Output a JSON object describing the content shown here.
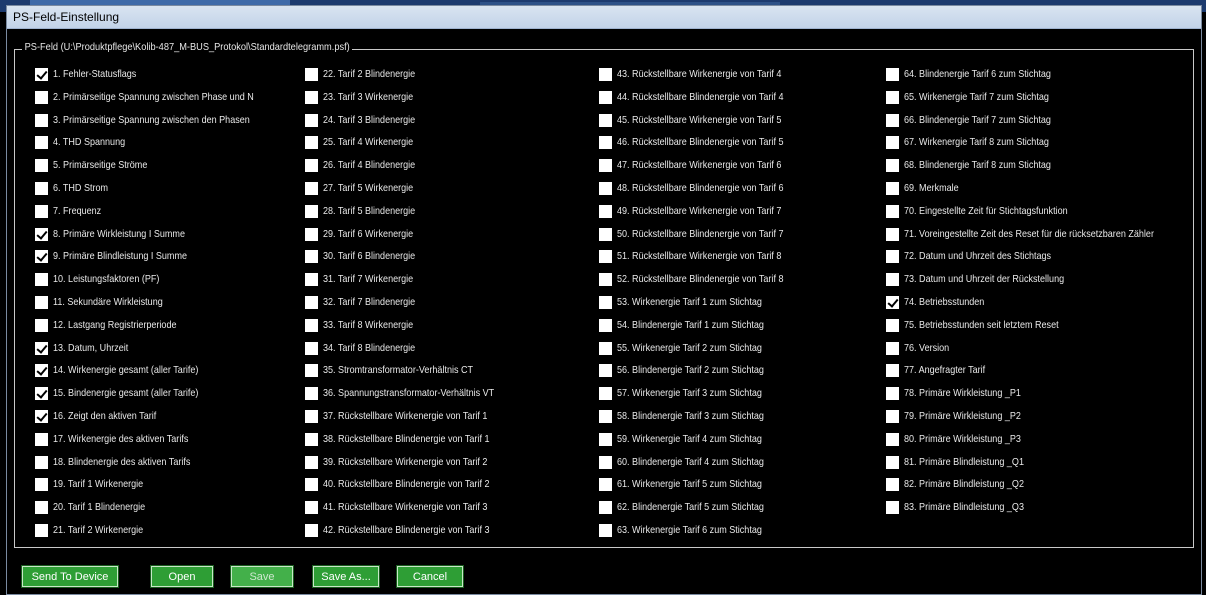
{
  "window": {
    "title": "PS-Feld-Einstellung"
  },
  "group": {
    "legend": "PS-Feld (U:\\Produktpflege\\Kolib-487_M-BUS_Protokol\\Standardtelegramm.psf)"
  },
  "fields": [
    {
      "label": "1. Fehler-Statusflags",
      "checked": true
    },
    {
      "label": "2. Primärseitige Spannung zwischen Phase und N",
      "checked": false
    },
    {
      "label": "3. Primärseitige Spannung zwischen den Phasen",
      "checked": false
    },
    {
      "label": "4. THD Spannung",
      "checked": false
    },
    {
      "label": "5. Primärseitige Ströme",
      "checked": false
    },
    {
      "label": "6. THD Strom",
      "checked": false
    },
    {
      "label": "7. Frequenz",
      "checked": false
    },
    {
      "label": "8. Primäre Wirkleistung I Summe",
      "checked": true
    },
    {
      "label": "9. Primäre Blindleistung I Summe",
      "checked": true
    },
    {
      "label": "10. Leistungsfaktoren (PF)",
      "checked": false
    },
    {
      "label": "11. Sekundäre Wirkleistung",
      "checked": false
    },
    {
      "label": "12. Lastgang Registrierperiode",
      "checked": false
    },
    {
      "label": "13. Datum, Uhrzeit",
      "checked": true
    },
    {
      "label": "14. Wirkenergie gesamt (aller Tarife)",
      "checked": true
    },
    {
      "label": "15. Bindenergie gesamt (aller Tarife)",
      "checked": true
    },
    {
      "label": "16. Zeigt den aktiven Tarif",
      "checked": true
    },
    {
      "label": "17. Wirkenergie des aktiven Tarifs",
      "checked": false
    },
    {
      "label": "18. Blindenergie des aktiven Tarifs",
      "checked": false
    },
    {
      "label": "19. Tarif 1 Wirkenergie",
      "checked": false
    },
    {
      "label": "20. Tarif 1 Blindenergie",
      "checked": false
    },
    {
      "label": "21. Tarif 2 Wirkenergie",
      "checked": false
    },
    {
      "label": "22. Tarif 2 Blindenergie",
      "checked": false
    },
    {
      "label": "23. Tarif 3 Wirkenergie",
      "checked": false
    },
    {
      "label": "24. Tarif 3 Blindenergie",
      "checked": false
    },
    {
      "label": "25. Tarif 4 Wirkenergie",
      "checked": false
    },
    {
      "label": "26. Tarif 4 Blindenergie",
      "checked": false
    },
    {
      "label": "27. Tarif 5 Wirkenergie",
      "checked": false
    },
    {
      "label": "28. Tarif 5 Blindenergie",
      "checked": false
    },
    {
      "label": "29. Tarif 6 Wirkenergie",
      "checked": false
    },
    {
      "label": "30. Tarif 6 Blindenergie",
      "checked": false
    },
    {
      "label": "31. Tarif 7 Wirkenergie",
      "checked": false
    },
    {
      "label": "32. Tarif 7 Blindenergie",
      "checked": false
    },
    {
      "label": "33. Tarif 8 Wirkenergie",
      "checked": false
    },
    {
      "label": "34. Tarif 8 Blindenergie",
      "checked": false
    },
    {
      "label": "35. Stromtransformator-Verhältnis CT",
      "checked": false
    },
    {
      "label": "36. Spannungstransformator-Verhältnis VT",
      "checked": false
    },
    {
      "label": "37. Rückstellbare Wirkenergie von Tarif 1",
      "checked": false
    },
    {
      "label": "38. Rückstellbare Blindenergie von Tarif 1",
      "checked": false
    },
    {
      "label": "39. Rückstellbare Wirkenergie von Tarif 2",
      "checked": false
    },
    {
      "label": "40. Rückstellbare Blindenergie von Tarif 2",
      "checked": false
    },
    {
      "label": "41. Rückstellbare Wirkenergie von Tarif 3",
      "checked": false
    },
    {
      "label": "42. Rückstellbare Blindenergie von Tarif 3",
      "checked": false
    },
    {
      "label": "43. Rückstellbare Wirkenergie von Tarif 4",
      "checked": false
    },
    {
      "label": "44. Rückstellbare Blindenergie von Tarif 4",
      "checked": false
    },
    {
      "label": "45. Rückstellbare Wirkenergie von Tarif 5",
      "checked": false
    },
    {
      "label": "46. Rückstellbare Blindenergie von Tarif 5",
      "checked": false
    },
    {
      "label": "47. Rückstellbare Wirkenergie von Tarif 6",
      "checked": false
    },
    {
      "label": "48. Rückstellbare Blindenergie von Tarif 6",
      "checked": false
    },
    {
      "label": "49. Rückstellbare Wirkenergie von Tarif 7",
      "checked": false
    },
    {
      "label": "50. Rückstellbare Blindenergie von Tarif 7",
      "checked": false
    },
    {
      "label": "51. Rückstellbare Wirkenergie von Tarif 8",
      "checked": false
    },
    {
      "label": "52. Rückstellbare Blindenergie von Tarif 8",
      "checked": false
    },
    {
      "label": "53. Wirkenergie Tarif 1 zum Stichtag",
      "checked": false
    },
    {
      "label": "54. Blindenergie Tarif 1 zum Stichtag",
      "checked": false
    },
    {
      "label": "55. Wirkenergie Tarif 2 zum Stichtag",
      "checked": false
    },
    {
      "label": "56. Blindenergie Tarif 2 zum Stichtag",
      "checked": false
    },
    {
      "label": "57. Wirkenergie Tarif 3 zum Stichtag",
      "checked": false
    },
    {
      "label": "58. Blindenergie Tarif 3 zum Stichtag",
      "checked": false
    },
    {
      "label": "59. Wirkenergie Tarif 4 zum Stichtag",
      "checked": false
    },
    {
      "label": "60. Blindenergie Tarif 4 zum Stichtag",
      "checked": false
    },
    {
      "label": "61. Wirkenergie Tarif 5 zum Stichtag",
      "checked": false
    },
    {
      "label": "62. Blindenergie Tarif 5 zum Stichtag",
      "checked": false
    },
    {
      "label": "63. Wirkenergie Tarif 6 zum Stichtag",
      "checked": false
    },
    {
      "label": "64. Blindenergie Tarif 6 zum Stichtag",
      "checked": false
    },
    {
      "label": "65. Wirkenergie Tarif 7 zum Stichtag",
      "checked": false
    },
    {
      "label": "66. Blindenergie Tarif 7 zum Stichtag",
      "checked": false
    },
    {
      "label": "67. Wirkenergie Tarif 8 zum Stichtag",
      "checked": false
    },
    {
      "label": "68. Blindenergie Tarif 8 zum Stichtag",
      "checked": false
    },
    {
      "label": "69. Merkmale",
      "checked": false
    },
    {
      "label": "70. Eingestellte Zeit für Stichtagsfunktion",
      "checked": false
    },
    {
      "label": "71. Voreingestellte Zeit des Reset für die rücksetzbaren Zähler",
      "checked": false
    },
    {
      "label": "72. Datum und Uhrzeit des Stichtags",
      "checked": false
    },
    {
      "label": "73. Datum und Uhrzeit der Rückstellung",
      "checked": false
    },
    {
      "label": "74. Betriebsstunden",
      "checked": true
    },
    {
      "label": "75. Betriebsstunden seit letztem Reset",
      "checked": false
    },
    {
      "label": "76. Version",
      "checked": false
    },
    {
      "label": "77. Angefragter Tarif",
      "checked": false
    },
    {
      "label": "78. Primäre Wirkleistung _P1",
      "checked": false
    },
    {
      "label": "79. Primäre Wirkleistung _P2",
      "checked": false
    },
    {
      "label": "80. Primäre Wirkleistung _P3",
      "checked": false
    },
    {
      "label": "81. Primäre Blindleistung _Q1",
      "checked": false
    },
    {
      "label": "82. Primäre Blindleistung _Q2",
      "checked": false
    },
    {
      "label": "83. Primäre Blindleistung _Q3",
      "checked": false
    }
  ],
  "buttons": {
    "send_to_device": "Send To Device",
    "open": "Open",
    "save": "Save",
    "save_as": "Save As...",
    "cancel": "Cancel"
  },
  "colors": {
    "accent_button": "#2e9e35",
    "background": "#000000",
    "title_bar": "#c9d8ec"
  }
}
